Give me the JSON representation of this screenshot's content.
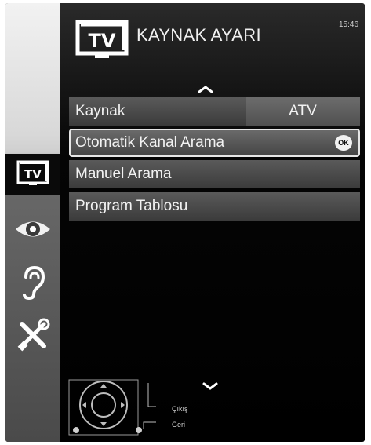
{
  "header": {
    "title": "KAYNAK AYARI",
    "clock": "15:46",
    "icon": "tv-icon"
  },
  "sidebar": {
    "items": [
      {
        "icon": "tv-icon",
        "active": true
      },
      {
        "icon": "eye-icon",
        "active": false
      },
      {
        "icon": "ear-icon",
        "active": false
      },
      {
        "icon": "tools-icon",
        "active": false
      }
    ]
  },
  "menu": {
    "items": [
      {
        "label": "Kaynak",
        "value": "ATV"
      },
      {
        "label": "Otomatik Kanal Arama",
        "badge": "OK",
        "selected": true
      },
      {
        "label": "Manuel Arama"
      },
      {
        "label": "Program Tablosu"
      }
    ]
  },
  "legend": {
    "exit_label": "Çıkış",
    "back_label": "Geri"
  },
  "colors": {
    "background": "#000000",
    "sidebar": "#d8d8d8",
    "row": "#4a4a4a",
    "text": "#f2f2f2"
  }
}
